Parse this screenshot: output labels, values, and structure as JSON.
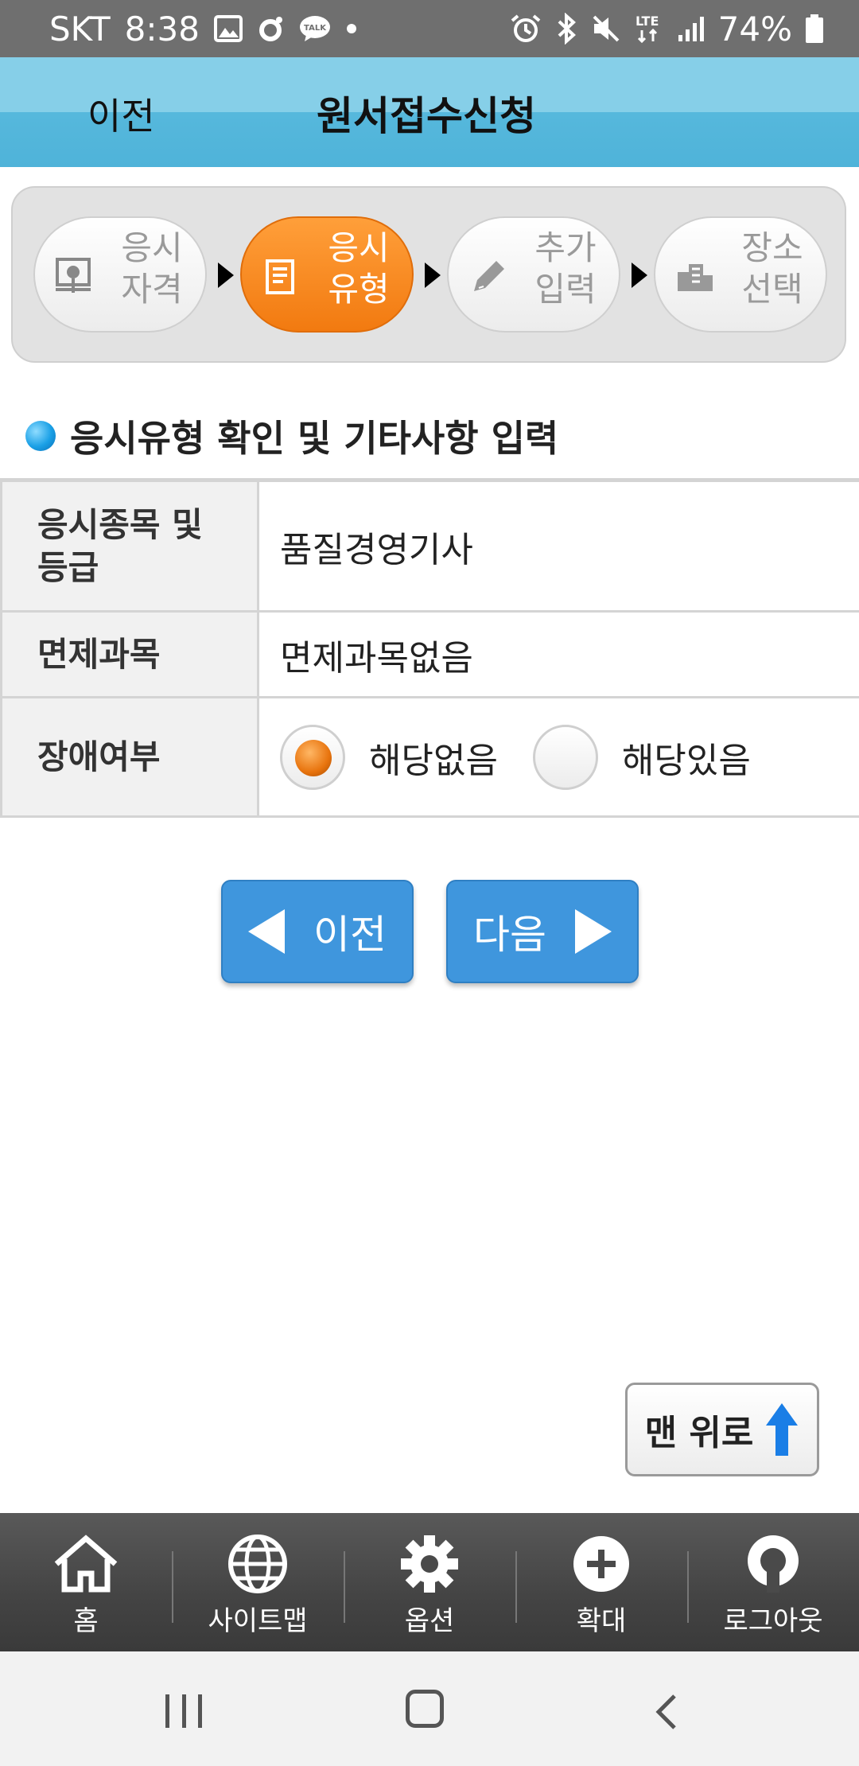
{
  "status_bar": {
    "carrier": "SKT",
    "time": "8:38",
    "network": "LTE",
    "battery": "74%",
    "icons": [
      "image-icon",
      "circle-app-icon",
      "talk-icon",
      "dot-icon",
      "alarm-icon",
      "bluetooth-icon",
      "mute-icon",
      "lte-icon",
      "signal-icon",
      "battery-icon"
    ],
    "talk_label": "TALK"
  },
  "header": {
    "back_label": "이전",
    "title": "원서접수신청"
  },
  "steps": [
    {
      "label_line1": "응시",
      "label_line2": "자격",
      "icon": "certificate-icon",
      "active": false
    },
    {
      "label_line1": "응시",
      "label_line2": "유형",
      "icon": "document-icon",
      "active": true
    },
    {
      "label_line1": "추가",
      "label_line2": "입력",
      "icon": "pencil-icon",
      "active": false
    },
    {
      "label_line1": "장소",
      "label_line2": "선택",
      "icon": "building-icon",
      "active": false
    }
  ],
  "section": {
    "title": "응시유형 확인 및 기타사항 입력"
  },
  "form": {
    "rows": [
      {
        "label": "응시종목 및 등급",
        "value": "품질경영기사"
      },
      {
        "label": "면제과목",
        "value": "면제과목없음"
      },
      {
        "label": "장애여부",
        "options": [
          "해당없음",
          "해당있음"
        ],
        "selected": "해당없음"
      }
    ]
  },
  "buttons": {
    "prev_label": "이전",
    "next_label": "다음",
    "to_top_label": "맨 위로"
  },
  "bottom_nav": [
    {
      "label": "홈",
      "icon": "home-icon"
    },
    {
      "label": "사이트맵",
      "icon": "globe-icon"
    },
    {
      "label": "옵션",
      "icon": "gear-icon"
    },
    {
      "label": "확대",
      "icon": "plus-circle-icon"
    },
    {
      "label": "로그아웃",
      "icon": "logout-icon"
    }
  ],
  "colors": {
    "header_top": "#86cfe8",
    "header_bottom": "#4fb3d9",
    "active_step": "#f27a10",
    "button_blue": "#3f96dd",
    "bottom_nav": "#444444"
  }
}
